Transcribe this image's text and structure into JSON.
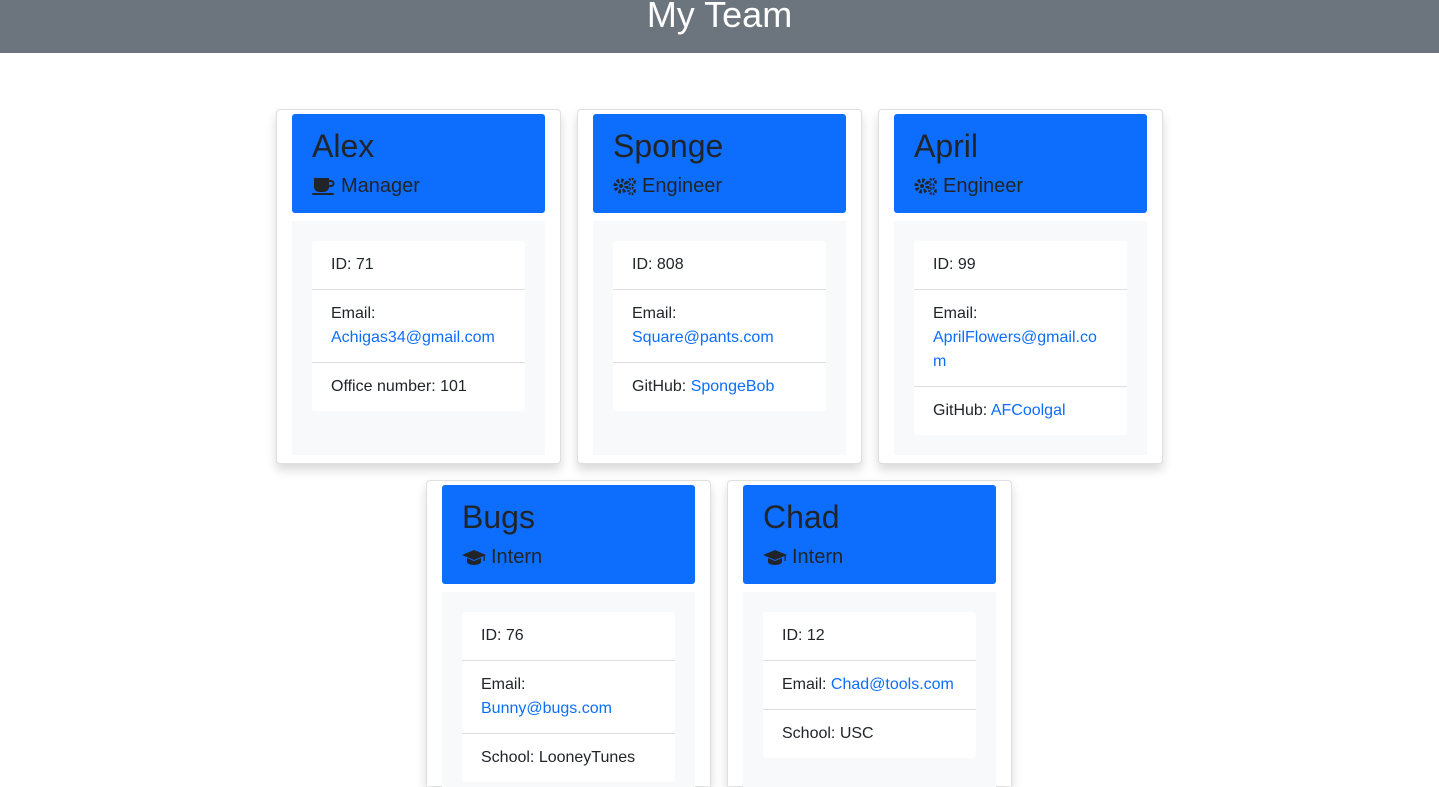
{
  "header": {
    "title": "My Team"
  },
  "employees": [
    {
      "name": "Alex",
      "role": "Manager",
      "role_icon": "mug-icon",
      "id_label": "ID: 71",
      "email_label": "Email:",
      "email": "Achigas34@gmail.com",
      "extra_label": "Office number: 101",
      "extra_link": ""
    },
    {
      "name": "Sponge",
      "role": "Engineer",
      "role_icon": "gears-icon",
      "id_label": "ID: 808",
      "email_label": "Email:",
      "email": "Square@pants.com",
      "extra_label": "GitHub:",
      "extra_link": "SpongeBob"
    },
    {
      "name": "April",
      "role": "Engineer",
      "role_icon": "gears-icon",
      "id_label": "ID: 99",
      "email_label": "Email:",
      "email": "AprilFlowers@gmail.com",
      "extra_label": "GitHub:",
      "extra_link": "AFCoolgal"
    },
    {
      "name": "Bugs",
      "role": "Intern",
      "role_icon": "graduation-cap-icon",
      "id_label": "ID: 76",
      "email_label": "Email:",
      "email": "Bunny@bugs.com",
      "extra_label": "School: LooneyTunes",
      "extra_link": ""
    },
    {
      "name": "Chad",
      "role": "Intern",
      "role_icon": "graduation-cap-icon",
      "id_label": "ID: 12",
      "email_label": "Email:",
      "email": "Chad@tools.com",
      "extra_label": "School: USC",
      "extra_link": ""
    }
  ],
  "colors": {
    "header_bg": "#6c757d",
    "card_header_bg": "#0d6efd",
    "link": "#0d6efd",
    "card_body_bg": "#f8f9fa"
  }
}
